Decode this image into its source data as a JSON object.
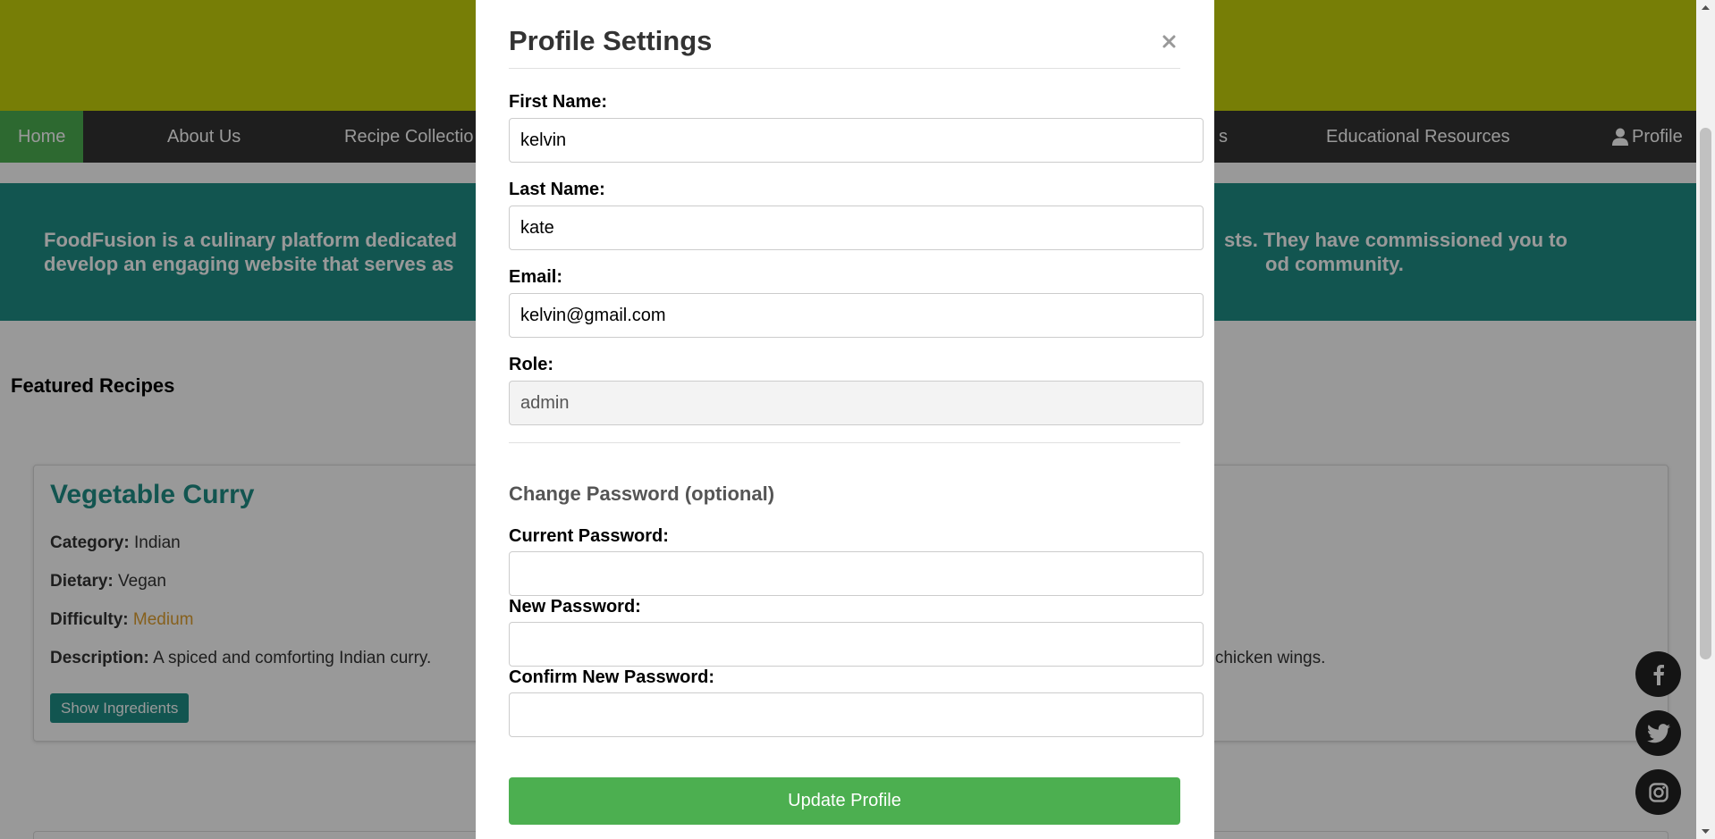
{
  "nav": {
    "items": [
      {
        "label": "Home",
        "active": true
      },
      {
        "label": "About Us"
      },
      {
        "label": "Recipe Collectio"
      },
      {
        "label": "s"
      },
      {
        "label": "Educational Resources"
      },
      {
        "label": "Profile"
      }
    ]
  },
  "banner": {
    "line1_left": "FoodFusion is a culinary platform dedicated",
    "line2_left": "develop an engaging website that serves as",
    "line1_right": "sts. They have commissioned you to",
    "line2_right": "od community."
  },
  "featured": {
    "heading": "Featured Recipes",
    "card": {
      "title": "Vegetable Curry",
      "category_label": "Category:",
      "category_value": "Indian",
      "dietary_label": "Dietary:",
      "dietary_value": "Vegan",
      "difficulty_label": "Difficulty:",
      "difficulty_value": "Medium",
      "description_label": "Description:",
      "description_value": "A spiced and comforting Indian curry.",
      "button_label": "Show Ingredients"
    },
    "right_card_description": "e chicken wings."
  },
  "social": {
    "icons": [
      "facebook-icon",
      "twitter-icon",
      "instagram-icon"
    ]
  },
  "modal": {
    "title": "Profile Settings",
    "close_symbol": "×",
    "first_name_label": "First Name:",
    "first_name_value": "kelvin",
    "last_name_label": "Last Name:",
    "last_name_value": "kate",
    "email_label": "Email:",
    "email_value": "kelvin@gmail.com",
    "role_label": "Role:",
    "role_value": "admin",
    "password_heading": "Change Password (optional)",
    "current_password_label": "Current Password:",
    "new_password_label": "New Password:",
    "confirm_password_label": "Confirm New Password:",
    "submit_label": "Update Profile"
  },
  "colors": {
    "top_band": "#c7d30a",
    "nav_bg": "#333333",
    "nav_active": "#4caf50",
    "banner_bg": "#1f8e86",
    "accent_green": "#4caf50",
    "recipe_title": "#1f8e86",
    "difficulty_medium": "#e0a030"
  }
}
